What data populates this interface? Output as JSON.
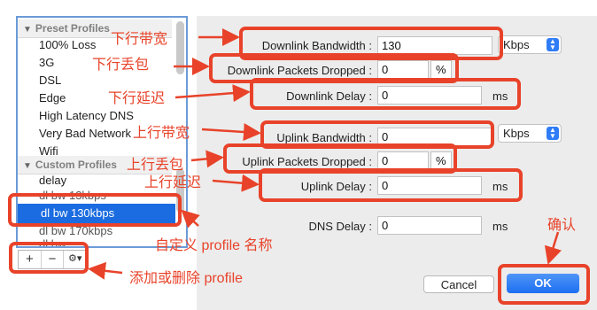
{
  "profiles": {
    "preset_header": "Preset Profiles",
    "preset": [
      "100% Loss",
      "3G",
      "DSL",
      "Edge",
      "High Latency DNS",
      "Very Bad Network",
      "Wifi"
    ],
    "custom_header": "Custom Profiles",
    "custom": [
      "delay",
      "dl bw 13kbps",
      "dl bw 130kbps",
      "dl bw 170kbps",
      "dl bw ..."
    ],
    "selected": "dl bw 130kbps"
  },
  "list_buttons": {
    "add": "+",
    "remove": "−",
    "gear": "⚙▾"
  },
  "form": {
    "downlink_bw_label": "Downlink Bandwidth :",
    "downlink_bw_value": "130",
    "downlink_bw_unit": "Kbps",
    "downlink_drop_label": "Downlink Packets Dropped :",
    "downlink_drop_value": "0",
    "downlink_drop_unit": "%",
    "downlink_delay_label": "Downlink Delay :",
    "downlink_delay_value": "0",
    "downlink_delay_unit": "ms",
    "uplink_bw_label": "Uplink Bandwidth :",
    "uplink_bw_value": "0",
    "uplink_bw_unit": "Kbps",
    "uplink_drop_label": "Uplink Packets Dropped :",
    "uplink_drop_value": "0",
    "uplink_drop_unit": "%",
    "uplink_delay_label": "Uplink Delay :",
    "uplink_delay_value": "0",
    "uplink_delay_unit": "ms",
    "dns_delay_label": "DNS Delay :",
    "dns_delay_value": "0",
    "dns_delay_unit": "ms"
  },
  "buttons": {
    "cancel": "Cancel",
    "ok": "OK"
  },
  "annotations": {
    "downlink_bw": "下行带宽",
    "downlink_drop": "下行丢包",
    "downlink_delay": "下行延迟",
    "uplink_bw": "上行带宽",
    "uplink_drop": "上行丢包",
    "uplink_delay": "上行延迟",
    "profile_name": "自定义 profile 名称",
    "add_remove": "添加或删除 profile",
    "confirm": "确认"
  },
  "colors": {
    "annotation": "#e8432a",
    "selection": "#1a6ce0",
    "accent": "#2f7cf6"
  }
}
